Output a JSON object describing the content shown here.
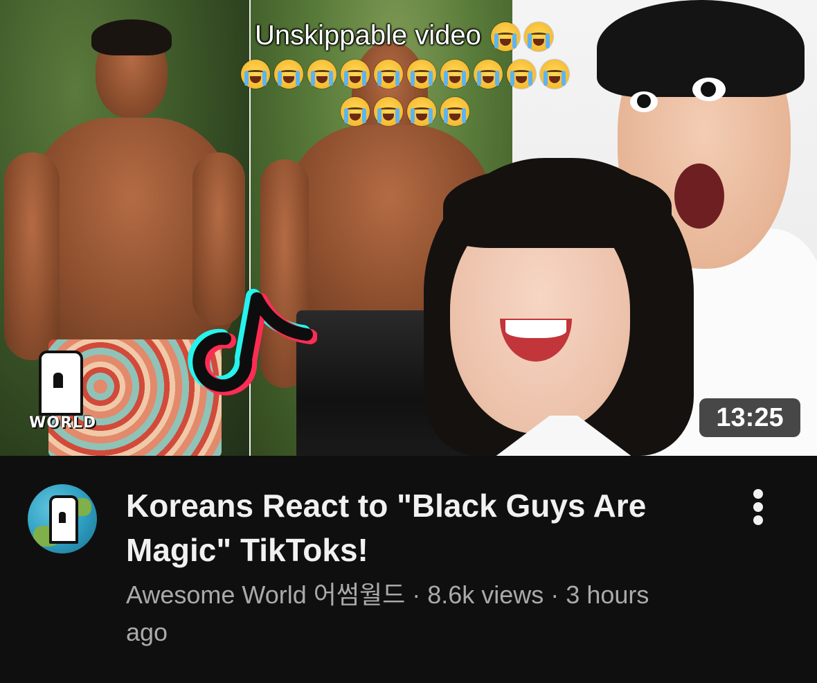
{
  "thumbnail": {
    "caption": {
      "line1_text": "Unskippable video",
      "line1_emoji_count": 2,
      "line2_emoji_count": 10,
      "line3_emoji_count": 4,
      "emoji_name": "loudly-crying-face"
    },
    "watermark": {
      "text": "WORLD"
    },
    "duration": "13:25"
  },
  "video": {
    "title": "Koreans React to \"Black Guys Are Magic\" TikToks!",
    "meta": "Awesome World 어썸월드 · 8.6k views · 3 hours ago"
  },
  "menu": {
    "icon": "vertical-ellipsis-icon"
  },
  "colors": {
    "background": "#0f0f0f",
    "title": "#f1f1f1",
    "meta": "#aaaaaa",
    "duration_badge": "#1e1e1e",
    "tiktok_cyan": "#25f4ee",
    "tiktok_red": "#fe2c55"
  }
}
